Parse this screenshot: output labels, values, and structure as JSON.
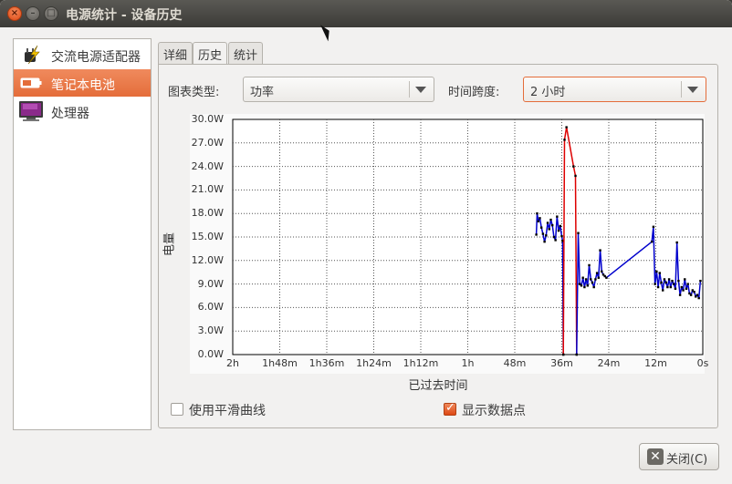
{
  "window": {
    "title": "电源统计 - 设备历史"
  },
  "devices": [
    {
      "label": "交流电源适配器",
      "icon": "ac-adapter-icon",
      "selected": false
    },
    {
      "label": "笔记本电池",
      "icon": "battery-icon",
      "selected": true
    },
    {
      "label": "处理器",
      "icon": "processor-icon",
      "selected": false
    }
  ],
  "tabs": [
    {
      "label": "详细",
      "active": false
    },
    {
      "label": "历史",
      "active": true
    },
    {
      "label": "统计",
      "active": false
    }
  ],
  "controls": {
    "graph_type_label": "图表类型:",
    "graph_type_value": "功率",
    "time_span_label": "时间跨度:",
    "time_span_value": "2 小时"
  },
  "options": {
    "smooth_label": "使用平滑曲线",
    "smooth_checked": false,
    "points_label": "显示数据点",
    "points_checked": true
  },
  "close_button": "关闭(C)",
  "colors": {
    "accent": "#e46d3a",
    "series_discharge": "#0000cc",
    "series_charge": "#dd0000"
  },
  "chart_data": {
    "type": "line",
    "ylabel": "电量",
    "xlabel": "已过去时间",
    "yticks": [
      "30.0W",
      "27.0W",
      "24.0W",
      "21.0W",
      "18.0W",
      "15.0W",
      "12.0W",
      "9.0W",
      "6.0W",
      "3.0W",
      "0.0W"
    ],
    "xticks": [
      "2h",
      "1h48m",
      "1h36m",
      "1h24m",
      "1h12m",
      "1h",
      "48m",
      "36m",
      "24m",
      "12m",
      "0s"
    ],
    "ylim": [
      0,
      30
    ],
    "xlim_minutes_ago": [
      120,
      0
    ],
    "series": [
      {
        "color": "#0000cc",
        "points": [
          [
            42.5,
            15.3
          ],
          [
            42.3,
            18.0
          ],
          [
            42.0,
            17.0
          ],
          [
            41.6,
            17.4
          ],
          [
            41.2,
            16.2
          ],
          [
            40.8,
            15.4
          ],
          [
            40.4,
            14.4
          ],
          [
            40.0,
            15.2
          ],
          [
            39.6,
            16.8
          ],
          [
            39.2,
            16.0
          ],
          [
            38.8,
            17.2
          ],
          [
            38.4,
            16.5
          ],
          [
            38.0,
            15.0
          ],
          [
            37.6,
            14.6
          ],
          [
            37.2,
            17.6
          ],
          [
            36.8,
            15.8
          ],
          [
            36.4,
            16.4
          ],
          [
            36.0,
            15.1
          ],
          [
            35.8,
            14.5
          ],
          [
            35.6,
            0.0
          ]
        ]
      },
      {
        "color": "#dd0000",
        "points": [
          [
            35.6,
            0.0
          ],
          [
            35.3,
            27.4
          ],
          [
            34.8,
            29.0
          ],
          [
            33.0,
            24.0
          ],
          [
            32.5,
            22.8
          ],
          [
            32.2,
            0.0
          ]
        ]
      },
      {
        "color": "#0000cc",
        "points": [
          [
            32.2,
            0.0
          ],
          [
            31.8,
            15.5
          ],
          [
            31.4,
            9.0
          ],
          [
            31.0,
            8.8
          ],
          [
            30.6,
            9.8
          ],
          [
            30.2,
            8.6
          ],
          [
            29.8,
            9.6
          ],
          [
            29.4,
            8.8
          ],
          [
            29.0,
            11.4
          ],
          [
            28.6,
            9.6
          ],
          [
            28.2,
            9.2
          ],
          [
            27.8,
            8.6
          ],
          [
            27.4,
            9.6
          ],
          [
            27.0,
            10.4
          ],
          [
            26.6,
            9.8
          ],
          [
            26.2,
            13.3
          ],
          [
            25.8,
            10.6
          ],
          [
            25.4,
            10.2
          ],
          [
            25.0,
            10.0
          ],
          [
            24.6,
            9.8
          ],
          [
            13.0,
            14.4
          ],
          [
            12.6,
            16.3
          ],
          [
            12.2,
            9.0
          ],
          [
            11.8,
            10.6
          ],
          [
            11.4,
            8.6
          ],
          [
            11.0,
            10.4
          ],
          [
            10.6,
            9.2
          ],
          [
            10.2,
            8.2
          ],
          [
            9.8,
            9.6
          ],
          [
            9.4,
            9.2
          ],
          [
            9.0,
            8.6
          ],
          [
            8.6,
            9.6
          ],
          [
            8.2,
            8.6
          ],
          [
            7.8,
            9.4
          ],
          [
            7.4,
            9.0
          ],
          [
            7.0,
            8.4
          ],
          [
            6.6,
            14.3
          ],
          [
            6.2,
            9.4
          ],
          [
            5.8,
            7.6
          ],
          [
            5.4,
            8.6
          ],
          [
            5.0,
            8.2
          ],
          [
            4.6,
            9.6
          ],
          [
            4.2,
            8.4
          ],
          [
            3.8,
            9.0
          ],
          [
            3.4,
            7.8
          ],
          [
            3.0,
            7.6
          ],
          [
            2.6,
            8.2
          ],
          [
            2.2,
            8.0
          ],
          [
            1.8,
            7.4
          ],
          [
            1.4,
            7.6
          ],
          [
            1.0,
            7.2
          ],
          [
            0.6,
            9.4
          ]
        ]
      }
    ]
  }
}
